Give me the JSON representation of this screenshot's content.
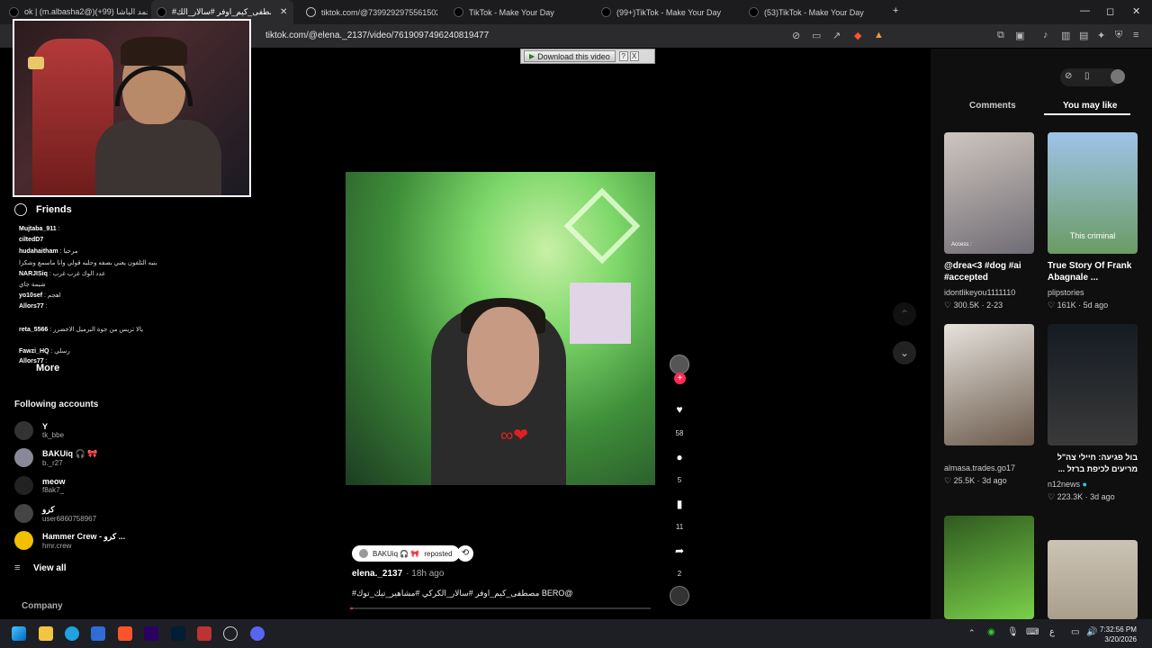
{
  "browser": {
    "tabs": [
      {
        "label": "ok | (m.albasha2@)محمد الباشا (99+)"
      },
      {
        "label": "#مصطفى_كيم_اوفر #سالار_الك"
      },
      {
        "label": "tiktok.com/@73992929755615027"
      },
      {
        "label": "TikTok - Make Your Day"
      },
      {
        "label": "(99+)TikTok - Make Your Day"
      },
      {
        "label": "(53)TikTok - Make Your Day"
      }
    ],
    "new_tab": "+",
    "url": "tiktok.com/@elena._2137/video/7619097496240819477"
  },
  "chat": [
    {
      "user": "Mujtaba_911",
      "msg": ""
    },
    {
      "user": "ciltedD7",
      "msg": ""
    },
    {
      "user": "hudahaitham",
      "msg": "مرحبا"
    },
    {
      "user": "",
      "msg": "بنيه التلفون يعني بصفه وحليه قولي وانا ماسمع وشكرا"
    },
    {
      "user": "NARJISiq",
      "msg": "عدد الوك غرب غرب"
    },
    {
      "user": "",
      "msg": "شيمة جاي"
    },
    {
      "user": "yo10sef",
      "msg": "اهجم"
    },
    {
      "user": "Allors77",
      "msg": ""
    },
    {
      "user": "",
      "msg": ""
    },
    {
      "user": "reta_5566",
      "msg": "يالا تريس من جوة البرميل الاخضرر"
    },
    {
      "user": "",
      "msg": ""
    },
    {
      "user": "Fawzi_HQ",
      "msg": "رسلي"
    },
    {
      "user": "Allors77",
      "msg": ""
    }
  ],
  "nav": {
    "friends": "Friends",
    "more": "More"
  },
  "following": {
    "title": "Following accounts",
    "accounts": [
      {
        "name": "Y",
        "handle": "tk_bbe"
      },
      {
        "name": "BAKUiq 🎧 🎀",
        "handle": "b._r27"
      },
      {
        "name": "meow",
        "handle": "f8ak7_"
      },
      {
        "name": "كرو",
        "handle": "user6860758967"
      },
      {
        "name": "Hammer Crew - كرو ...",
        "handle": "hmr.crew"
      }
    ],
    "view_all": "View all",
    "company": "Company"
  },
  "download": {
    "label": "Download this video",
    "help": "?",
    "close": "X"
  },
  "video": {
    "repost_user": "BAKUiq 🎧 🎀",
    "repost_word": "reposted",
    "author": "elena._2137",
    "time": "· 18h ago",
    "caption": "#مصطفى_كيم_اوفر #سالار_الكركي #مشاهير_تيك_توك BERO@",
    "progress": 0.01
  },
  "actions": {
    "likes": "58",
    "comments": "5",
    "saves": "11",
    "shares": "2"
  },
  "right_panel": {
    "tab_comments": "Comments",
    "tab_you_may_like": "You may like",
    "videos": [
      {
        "title": "@drea<3 #dog #ai #accepted",
        "user": "idontlikeyou1111110",
        "stats": "300.5K · 2-23",
        "overlay": "Access :"
      },
      {
        "title": "True Story Of Frank Abagnale ...",
        "user": "plipstories",
        "stats": "161K · 5d ago",
        "overlay": "This criminal"
      },
      {
        "title": "",
        "user": "almasa.trades.go17",
        "stats": "25.5K · 3d ago",
        "overlay": ""
      },
      {
        "title": "בול פגיעה: חיילי צה\"ל מריעים לכיפת ברזל ...",
        "user": "n12news",
        "stats": "223.3K · 3d ago",
        "overlay": ""
      }
    ]
  },
  "taskbar": {
    "time": "7:32:56 PM",
    "date": "3/20/2026",
    "lang": "ع"
  },
  "colors": {
    "accent": "#fe2c55",
    "panel": "#0f0f0f"
  }
}
